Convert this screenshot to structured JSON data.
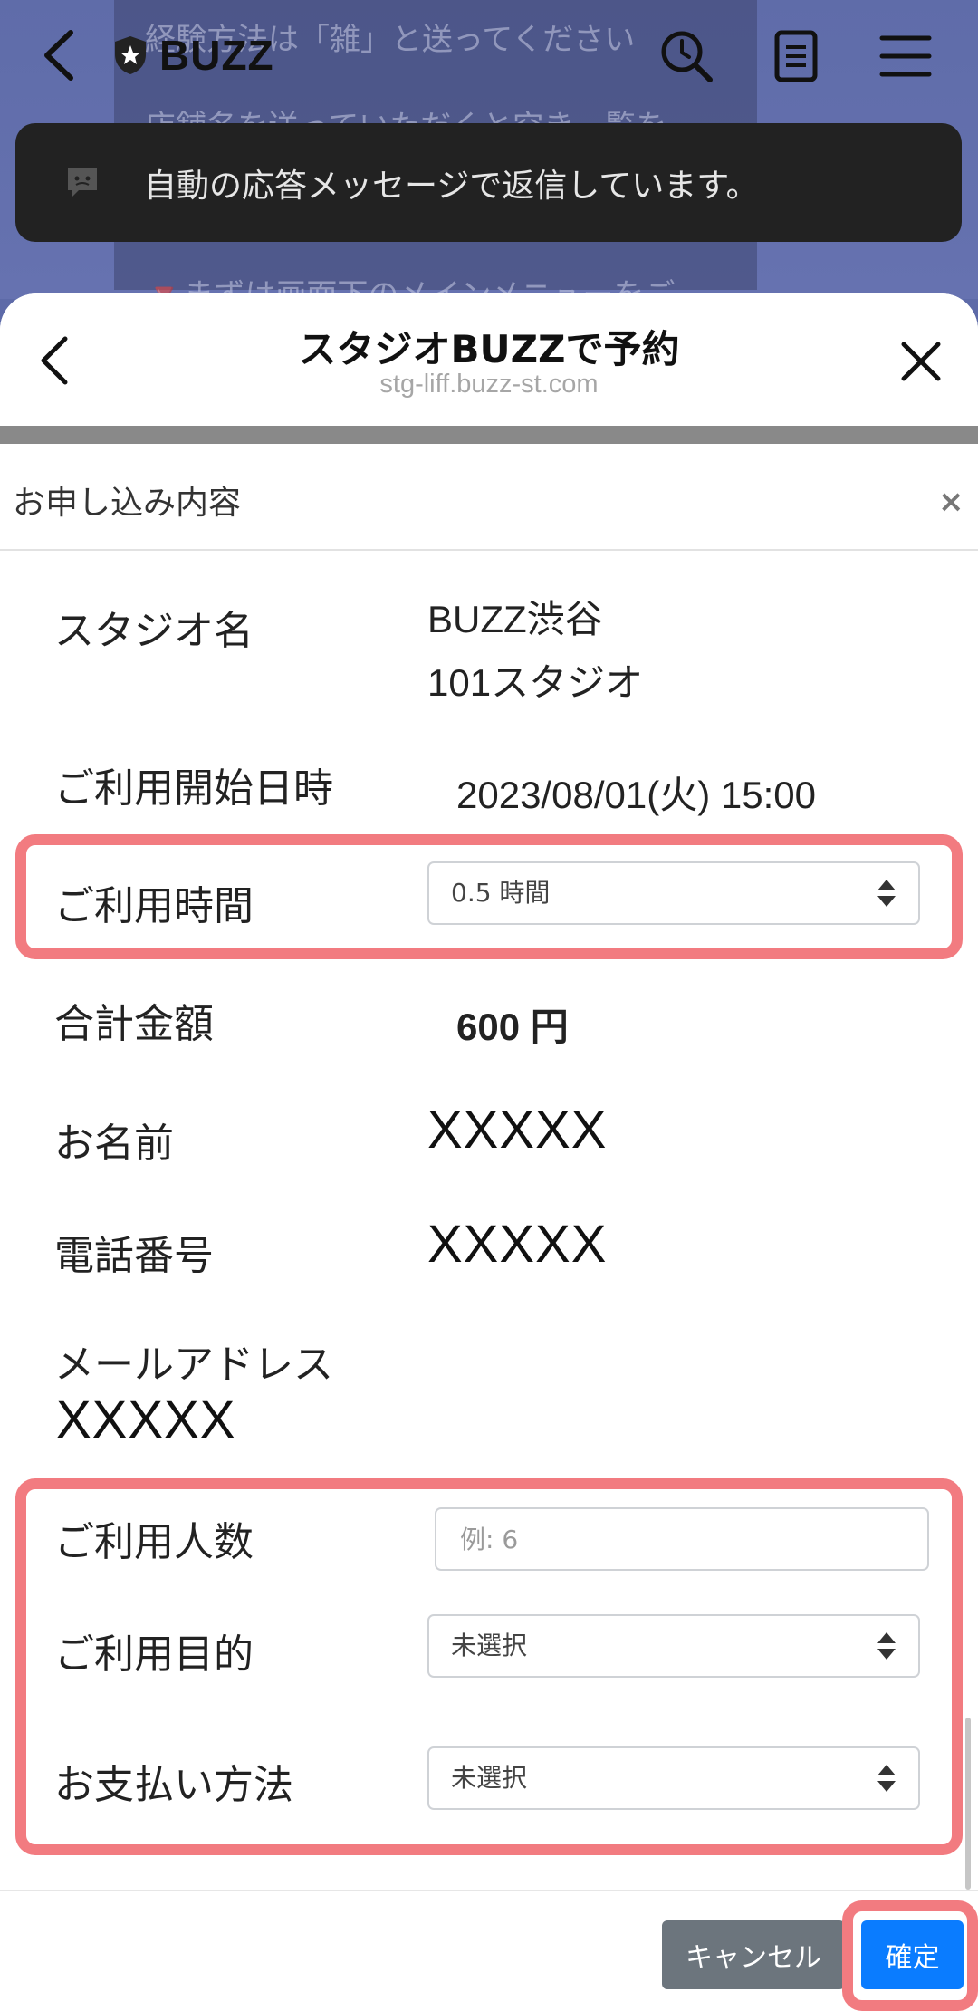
{
  "background": {
    "chat_line_1": "経験方法は「雑」と送ってください",
    "chat_line_2": "店舗名を送っていただくと空き一覧を",
    "chat_line_3": "🔻まずは画面下のメインメニューをご",
    "brand_name": "BUZZ",
    "toast_message": "自動の応答メッセージで返信しています。"
  },
  "sheet": {
    "title": "スタジオBUZZで予約",
    "url": "stg-liff.buzz-st.com"
  },
  "modal": {
    "title": "お申し込み内容",
    "close_symbol": "×"
  },
  "form": {
    "studio_label": "スタジオ名",
    "studio_name_line1": "BUZZ渋谷",
    "studio_name_line2": "101スタジオ",
    "start_label": "ご利用開始日時",
    "start_value": "2023/08/01(火) 15:00",
    "duration_label": "ご利用時間",
    "duration_value": "0.5 時間",
    "total_label": "合計金額",
    "total_value": "600 円",
    "name_label": "お名前",
    "name_value": "XXXXX",
    "phone_label": "電話番号",
    "phone_value": "XXXXX",
    "email_label": "メールアドレス",
    "email_value": "XXXXX",
    "people_label": "ご利用人数",
    "people_placeholder": "例: 6",
    "purpose_label": "ご利用目的",
    "purpose_value": "未選択",
    "payment_label": "お支払い方法",
    "payment_value": "未選択"
  },
  "buttons": {
    "cancel": "キャンセル",
    "confirm": "確定"
  },
  "colors": {
    "highlight": "#f27b80",
    "confirm_button": "#0a7cff",
    "cancel_button": "#6c757d"
  }
}
